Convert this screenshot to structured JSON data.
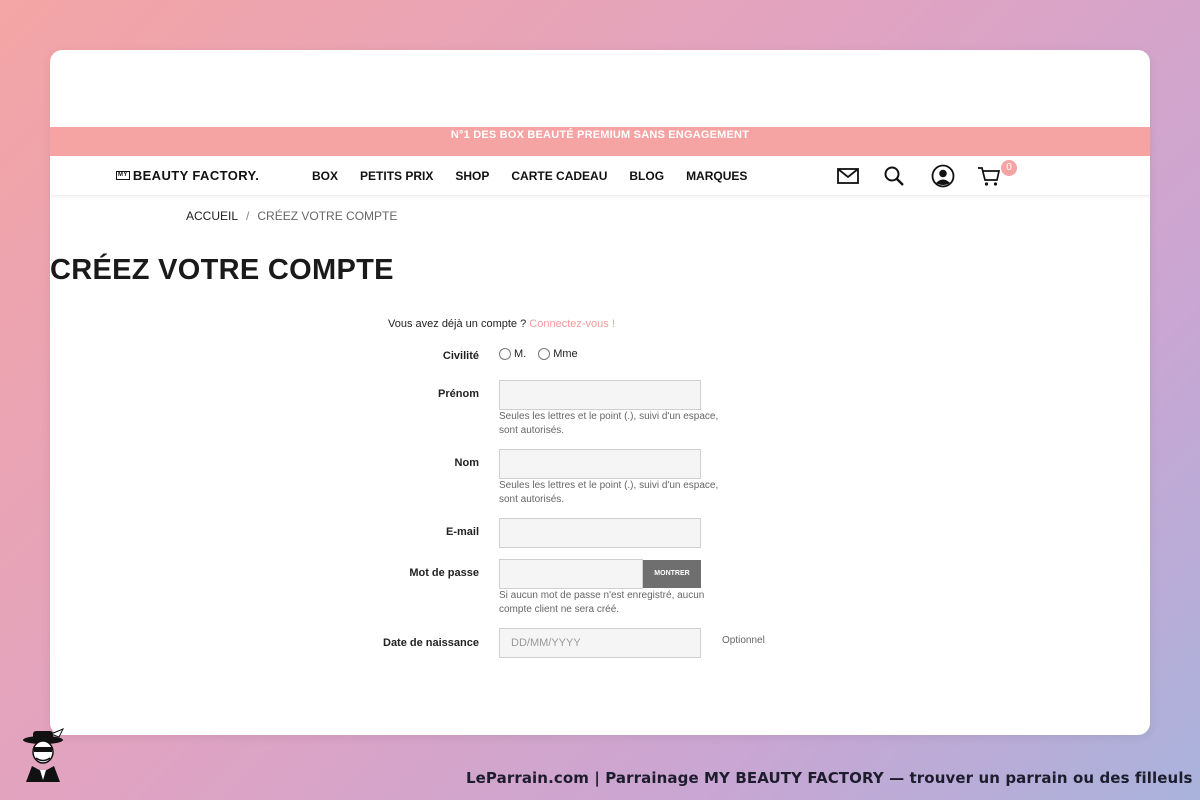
{
  "promo": {
    "text": "N°1 DES BOX BEAUTÉ PREMIUM SANS ENGAGEMENT"
  },
  "header": {
    "logo_prefix": "MY",
    "logo_text": "BEAUTY FACTORY.",
    "menu": [
      {
        "label": "BOX"
      },
      {
        "label": "PETITS PRIX"
      },
      {
        "label": "SHOP"
      },
      {
        "label": "CARTE CADEAU"
      },
      {
        "label": "BLOG"
      },
      {
        "label": "MARQUES"
      }
    ],
    "cart_count": "0"
  },
  "breadcrumb": {
    "home": "ACCUEIL",
    "separator": "/",
    "current": "CRÉEZ VOTRE COMPTE"
  },
  "page": {
    "title": "CRÉEZ VOTRE COMPTE"
  },
  "form": {
    "login_prompt": "Vous avez déjà un compte ?",
    "login_link": "Connectez-vous !",
    "civility": {
      "label": "Civilité",
      "options": [
        "M.",
        "Mme"
      ]
    },
    "firstname": {
      "label": "Prénom",
      "help": "Seules les lettres et le point (.), suivi d'un espace, sont autorisés."
    },
    "lastname": {
      "label": "Nom",
      "help": "Seules les lettres et le point (.), suivi d'un espace, sont autorisés."
    },
    "email": {
      "label": "E-mail"
    },
    "password": {
      "label": "Mot de passe",
      "show_button": "MONTRER",
      "help": "Si aucun mot de passe n'est enregistré, aucun compte client ne sera créé."
    },
    "birthdate": {
      "label": "Date de naissance",
      "placeholder": "DD/MM/YYYY",
      "optional": "Optionnel"
    }
  },
  "footer": {
    "caption": "LeParrain.com | Parrainage MY BEAUTY FACTORY — trouver un parrain ou des filleuls"
  },
  "colors": {
    "accent": "#f6a3a3",
    "link": "#f19b9b",
    "button": "#6f6f6f"
  }
}
